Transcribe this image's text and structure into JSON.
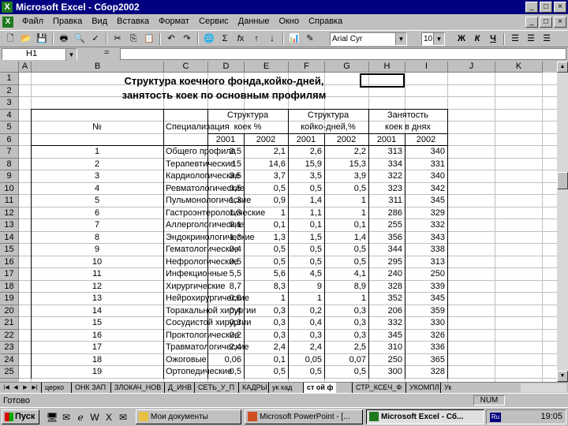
{
  "window": {
    "title": "Microsoft Excel - Сбор2002",
    "controls": [
      "_",
      "□",
      "×"
    ]
  },
  "menu": [
    "Файл",
    "Правка",
    "Вид",
    "Вставка",
    "Формат",
    "Сервис",
    "Данные",
    "Окно",
    "Справка"
  ],
  "toolbar": {
    "font_name": "Arial Cyr",
    "font_size": "10",
    "bold": "Ж",
    "italic": "К",
    "underline": "Ч"
  },
  "formula_bar": {
    "name_box": "H1",
    "equals": "=",
    "value": ""
  },
  "columns": [
    "A",
    "B",
    "C",
    "D",
    "E",
    "F",
    "G",
    "H",
    "I",
    "J",
    "K"
  ],
  "rows": [
    "1",
    "2",
    "3",
    "4",
    "5",
    "6",
    "7",
    "8",
    "9",
    "10",
    "11",
    "12",
    "13",
    "14",
    "15",
    "16",
    "17",
    "18",
    "19",
    "20",
    "21",
    "22",
    "23",
    "24",
    "25"
  ],
  "sheet": {
    "title_line1": "Структура коечного фонда,койко-дней,",
    "title_line2": "занятость коек по основным профилям",
    "hdr_num": "№",
    "hdr_spec": "Специализация",
    "hdr_g1a": "Структура",
    "hdr_g1b": "коек  %",
    "hdr_g2a": "Структура",
    "hdr_g2b": "койко-дней,%",
    "hdr_g3a": "Занятость",
    "hdr_g3b": "коек в днях",
    "years": [
      "2001",
      "2002",
      "2001",
      "2002",
      "2001",
      "2002"
    ],
    "data": [
      [
        "1",
        "Общего профиля",
        "2,5",
        "2,1",
        "2,6",
        "2,2",
        "313",
        "340"
      ],
      [
        "2",
        "Терапевтические",
        "15",
        "14,6",
        "15,9",
        "15,3",
        "334",
        "331"
      ],
      [
        "3",
        "Кардиологические",
        "3,5",
        "3,7",
        "3,5",
        "3,9",
        "322",
        "340"
      ],
      [
        "4",
        "Ревматологические",
        "0,5",
        "0,5",
        "0,5",
        "0,5",
        "323",
        "342"
      ],
      [
        "5",
        "Пульмонологические",
        "1,3",
        "0,9",
        "1,4",
        "1",
        "311",
        "345"
      ],
      [
        "6",
        "Гастроэнтерологические",
        "1,3",
        "1",
        "1,1",
        "1",
        "286",
        "329"
      ],
      [
        "7",
        "Аллергологические",
        "0,1",
        "0,1",
        "0,1",
        "0,1",
        "255",
        "332"
      ],
      [
        "8",
        "Эндокринологические",
        "1,3",
        "1,3",
        "1,5",
        "1,4",
        "356",
        "343"
      ],
      [
        "9",
        "Гематологические",
        "0,4",
        "0,5",
        "0,5",
        "0,5",
        "344",
        "338"
      ],
      [
        "10",
        "Нефрологические",
        "0,5",
        "0,5",
        "0,5",
        "0,5",
        "295",
        "313"
      ],
      [
        "11",
        "Инфекционные",
        "5,5",
        "5,6",
        "4,5",
        "4,1",
        "240",
        "250"
      ],
      [
        "12",
        "Хирургические",
        "8,7",
        "8,3",
        "9",
        "8,9",
        "328",
        "339"
      ],
      [
        "13",
        "Нейрохирургические",
        "0,9",
        "1",
        "1",
        "1",
        "352",
        "345"
      ],
      [
        "14",
        "Торакальной хирургии",
        "0,4",
        "0,3",
        "0,2",
        "0,3",
        "206",
        "359"
      ],
      [
        "15",
        "Сосудистой хирургии",
        "0,3",
        "0,3",
        "0,4",
        "0,3",
        "332",
        "330"
      ],
      [
        "16",
        "Проктологические",
        "0,2",
        "0,3",
        "0,3",
        "0,3",
        "345",
        "326"
      ],
      [
        "17",
        "Травматологические",
        "2,4",
        "2,4",
        "2,4",
        "2,5",
        "310",
        "336"
      ],
      [
        "18",
        "Ожоговые",
        "0,06",
        "0,1",
        "0,05",
        "0,07",
        "250",
        "365"
      ],
      [
        "19",
        "Ортопедические",
        "0,5",
        "0,5",
        "0,5",
        "0,5",
        "300",
        "328"
      ]
    ]
  },
  "tabs": [
    "церко",
    "ОНК ЗАП",
    "ЗЛОКАЧ_НОВ",
    "Д_ИНВ",
    "СЕТЬ_У_П",
    "КАДРЫ",
    "ук кад",
    "ст  ой  ф",
    "СТР_КСЕЧ_Ф",
    "УКОМПЛ",
    "Ук"
  ],
  "active_tab": "ст  ой  ф",
  "status": {
    "text": "Готово",
    "num": "NUM"
  },
  "taskbar": {
    "start": "Пуск",
    "tasks": [
      "Мои документы",
      "Microsoft PowerPoint - [...",
      "Microsoft Excel - Сб..."
    ],
    "clock": "19:05",
    "lang": "Ru"
  }
}
